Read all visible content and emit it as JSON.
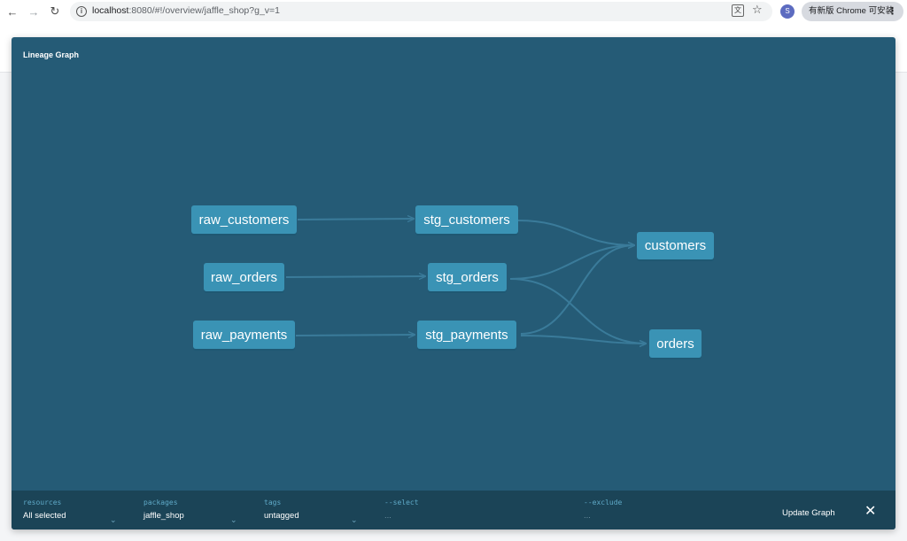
{
  "browser": {
    "url_host": "localhost",
    "url_path": ":8080/#!/overview/jaffle_shop?g_v=1",
    "profile_initial": "S",
    "update_chip": "有新版 Chrome 可安装"
  },
  "modal": {
    "title": "Lineage Graph"
  },
  "graph": {
    "nodes": {
      "raw_customers": "raw_customers",
      "raw_orders": "raw_orders",
      "raw_payments": "raw_payments",
      "stg_customers": "stg_customers",
      "stg_orders": "stg_orders",
      "stg_payments": "stg_payments",
      "customers": "customers",
      "orders": "orders"
    },
    "edges": [
      [
        "raw_customers",
        "stg_customers"
      ],
      [
        "raw_orders",
        "stg_orders"
      ],
      [
        "raw_payments",
        "stg_payments"
      ],
      [
        "stg_customers",
        "customers"
      ],
      [
        "stg_orders",
        "customers"
      ],
      [
        "stg_payments",
        "customers"
      ],
      [
        "stg_orders",
        "orders"
      ],
      [
        "stg_payments",
        "orders"
      ]
    ],
    "colors": {
      "background": "#255b76",
      "node": "#3a93b5",
      "edge": "#3d7f9e"
    }
  },
  "filters": {
    "resources": {
      "label": "resources",
      "value": "All selected"
    },
    "packages": {
      "label": "packages",
      "value": "jaffle_shop"
    },
    "tags": {
      "label": "tags",
      "value": "untagged"
    },
    "select": {
      "label": "--select",
      "value": "..."
    },
    "exclude": {
      "label": "--exclude",
      "value": "..."
    },
    "update_label": "Update Graph"
  }
}
